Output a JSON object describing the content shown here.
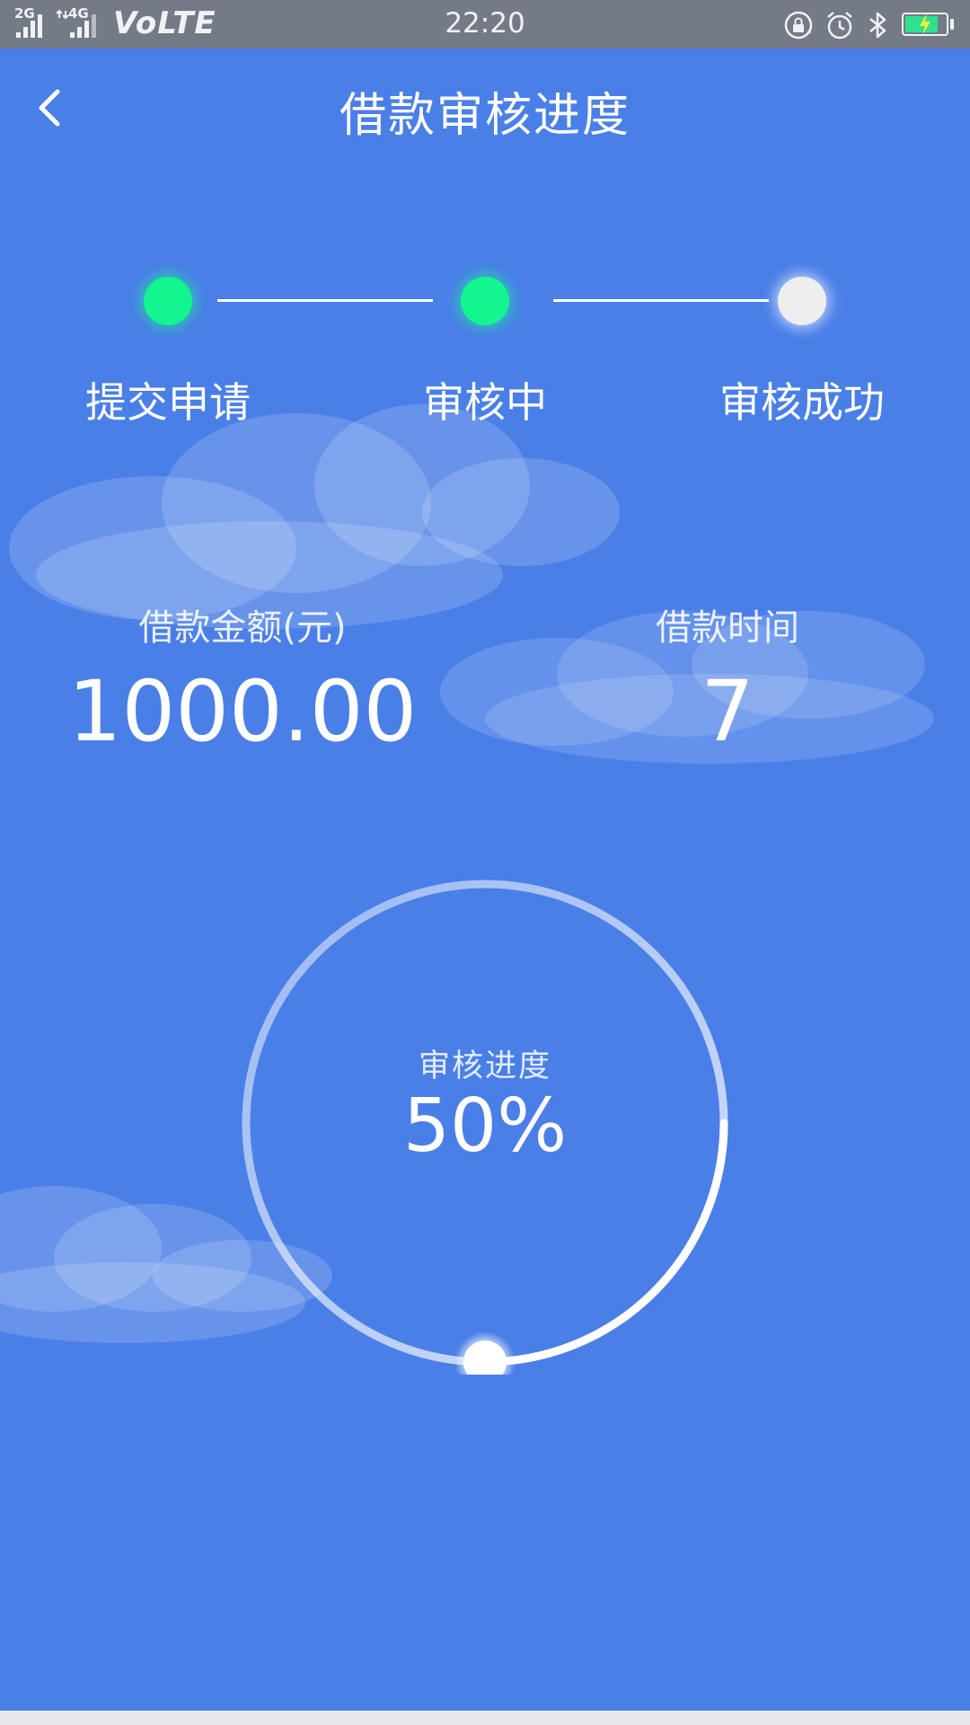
{
  "status_bar": {
    "net_2g": "2G",
    "net_4g": "4G",
    "volte": "VoLTE",
    "time": "22:20",
    "battery_level": 0.82,
    "icons": [
      "lock-rotation-icon",
      "alarm-icon",
      "bluetooth-icon",
      "battery-charging-icon"
    ]
  },
  "header": {
    "title": "借款审核进度",
    "back_icon": "chevron-left-icon"
  },
  "steps": [
    {
      "label": "提交申请",
      "status": "done"
    },
    {
      "label": "审核中",
      "status": "done"
    },
    {
      "label": "审核成功",
      "status": "pending"
    }
  ],
  "loan": {
    "amount_label": "借款金额(元)",
    "amount_value": "1000.00",
    "term_label": "借款时间",
    "term_value": "7"
  },
  "progress": {
    "label": "审核进度",
    "value_text": "50%",
    "fraction": 0.5
  },
  "colors": {
    "background": "#4a7fe8",
    "step_done": "#12f58f",
    "step_pending": "#eeeeee",
    "status_bar": "#737b86"
  }
}
